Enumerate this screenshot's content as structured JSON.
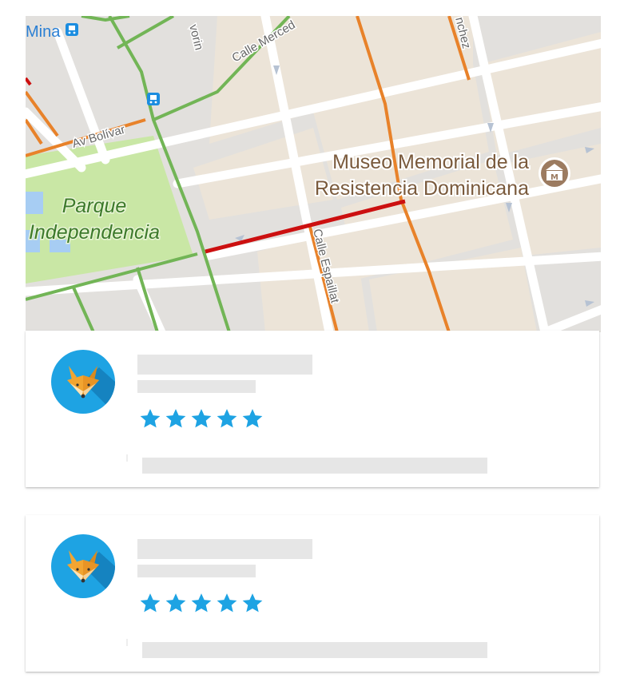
{
  "map": {
    "labels": {
      "mina": "Mina",
      "calle_mercedes": "Calle Merced",
      "vorin": "vorin",
      "nchez": "nchez",
      "av_bolivar": "Av Bolívar",
      "museo_line1": "Museo Memorial de la",
      "museo_line2": "Resistencia Dominicana",
      "parque_line1": "Parque",
      "parque_line2": "Independencia",
      "calle_espaillat": "Calle Espaillat"
    },
    "icons": {
      "bus_stop": "bus-stop-icon",
      "museum": "museum-icon"
    },
    "colors": {
      "background": "#e2e0dd",
      "block": "#ece4d8",
      "park": "#c9e7a5",
      "water": "#a7cdf3",
      "street": "#ffffff",
      "traffic_green": "#72b556",
      "traffic_orange": "#e8822a",
      "traffic_red": "#cc1010",
      "poi_text": "#7a5a3c",
      "park_text": "#3d7a2b",
      "street_text": "#5f6368",
      "museum_pin": "#9c7b60",
      "transit_blue": "#1b8de0"
    }
  },
  "reviews": [
    {
      "avatar_icon": "fox-icon",
      "rating": 5,
      "rating_max": 5,
      "rating_label": "5 out of 5 stars"
    },
    {
      "avatar_icon": "fox-icon",
      "rating": 5,
      "rating_max": 5,
      "rating_label": "5 out of 5 stars"
    }
  ],
  "theme": {
    "avatar_bg": "#1ea3e3",
    "star_color": "#1ea3e3",
    "placeholder": "#e6e6e6"
  }
}
